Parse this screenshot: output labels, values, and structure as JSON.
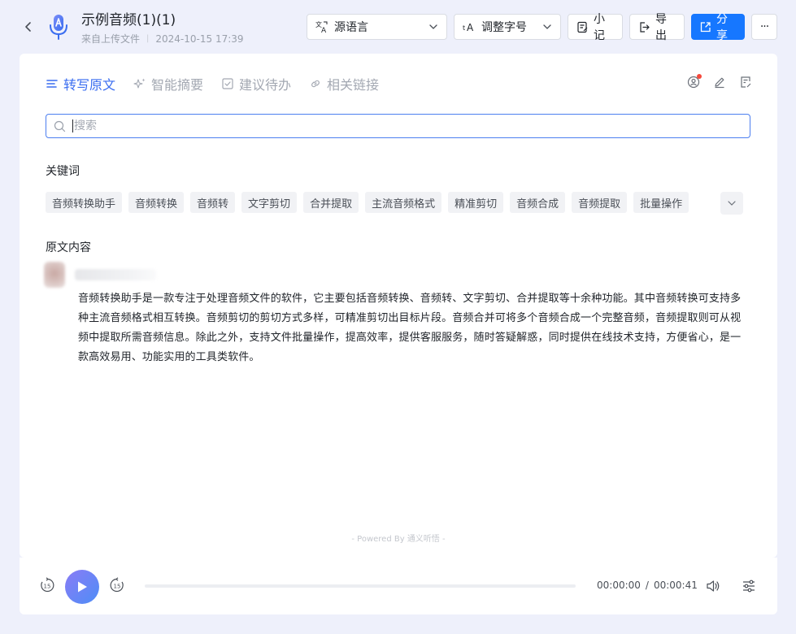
{
  "header": {
    "title": "示例音频(1)(1)",
    "source": "来自上传文件",
    "separator": "|",
    "datetime": "2024-10-15 17:39",
    "language_select": "源语言",
    "font_size_select": "调整字号",
    "note_label": "小记",
    "export_label": "导出",
    "share_label": "分享",
    "more_label": "···"
  },
  "tabs": [
    {
      "label": "转写原文",
      "icon": "lines-icon",
      "active": true
    },
    {
      "label": "智能摘要",
      "icon": "sparkle-icon",
      "active": false
    },
    {
      "label": "建议待办",
      "icon": "checkbox-icon",
      "active": false
    },
    {
      "label": "相关链接",
      "icon": "link-icon",
      "active": false
    }
  ],
  "search": {
    "placeholder": "搜索",
    "value": ""
  },
  "keywords_label": "关键词",
  "keywords": [
    "音频转换助手",
    "音频转换",
    "音频转",
    "文字剪切",
    "合并提取",
    "主流音频格式",
    "精准剪切",
    "音频合成",
    "音频提取",
    "批量操作"
  ],
  "original_label": "原文内容",
  "transcript": "音频转换助手是一款专注于处理音频文件的软件，它主要包括音频转换、音频转、文字剪切、合并提取等十余种功能。其中音频转换可支持多种主流音频格式相互转换。音频剪切的剪切方式多样，可精准剪切出目标片段。音频合并可将多个音频合成一个完整音频，音频提取则可从视频中提取所需音频信息。除此之外，支持文件批量操作，提高效率，提供客服服务，随时答疑解惑，同时提供在线技术支持，方便省心，是一款高效易用、功能实用的工具类软件。",
  "powered_by": "- Powered By 通义听悟 -",
  "player": {
    "current_time": "00:00:00",
    "time_separator": "/",
    "total_time": "00:00:41",
    "progress": 0,
    "skip_seconds": "15"
  },
  "colors": {
    "accent": "#3a6df0",
    "share": "#1677ff",
    "play_gradient": [
      "#8a7cf5",
      "#4e8df7"
    ]
  }
}
